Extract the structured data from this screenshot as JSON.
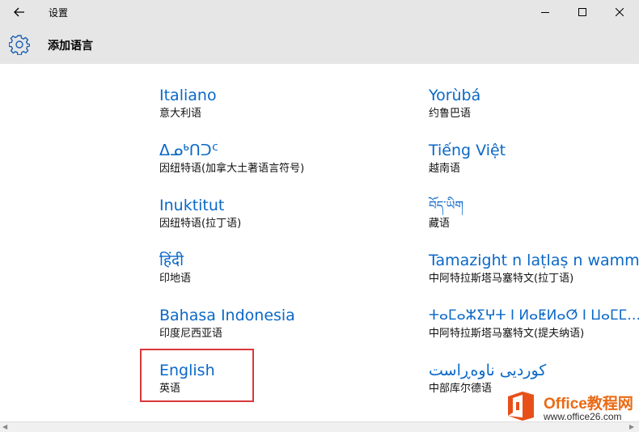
{
  "titlebar": {
    "title": "设置",
    "back_icon": "back-arrow-icon",
    "minimize_icon": "minimize-icon",
    "maximize_icon": "maximize-icon",
    "close_icon": "close-icon"
  },
  "page": {
    "title": "添加语言",
    "icon": "gear-icon",
    "accent_color": "#0a68c7"
  },
  "languages": {
    "left": [
      {
        "native": "Italiano",
        "local": "意大利语"
      },
      {
        "native": "ᐃᓄᒃᑎᑐᑦ",
        "local": "因纽特语(加拿大土著语言符号)"
      },
      {
        "native": "Inuktitut",
        "local": "因纽特语(拉丁语)"
      },
      {
        "native": "हिंदी",
        "local": "印地语"
      },
      {
        "native": "Bahasa Indonesia",
        "local": "印度尼西亚语"
      },
      {
        "native": "English",
        "local": "英语"
      }
    ],
    "right": [
      {
        "native": "Yorùbá",
        "local": "约鲁巴语"
      },
      {
        "native": "Tiếng Việt",
        "local": "越南语"
      },
      {
        "native": "བོད་ཡིག",
        "local": "藏语"
      },
      {
        "native": "Tamazight n laṭlaṣ n wamm…",
        "local": "中阿特拉斯塔马塞特文(拉丁语)"
      },
      {
        "native": "ⵜⴰⵎⴰⵣⵉⵖⵜ ⵏ ⵍⴰⵟⵍⴰⵚ ⵏ ⵡⴰⵎⵎ…",
        "local": "中阿特拉斯塔马塞特文(提夫纳语)"
      },
      {
        "native": "کوردیی ناوەڕاست",
        "local": "中部库尔德语"
      }
    ]
  },
  "watermark": {
    "title": "Office教程网",
    "url": "www.office26.com"
  }
}
